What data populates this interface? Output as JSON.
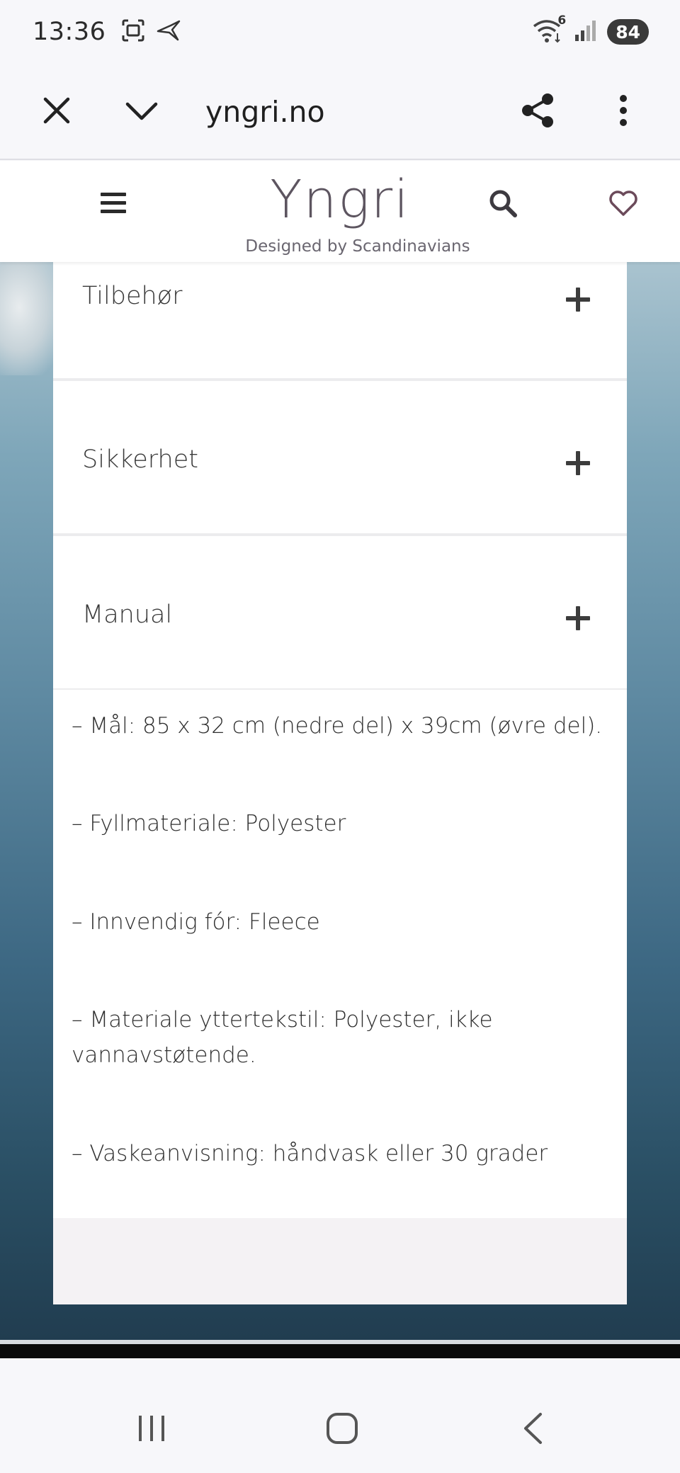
{
  "status_bar": {
    "time": "13:36",
    "battery": "84",
    "wifi_badge": "6",
    "icons": [
      "screenshot-icon",
      "bird-icon",
      "wifi-icon",
      "signal-icon"
    ]
  },
  "browser": {
    "url": "yngri.no",
    "icons": [
      "close-icon",
      "chevron-down-icon",
      "share-icon",
      "more-vert-icon"
    ]
  },
  "site_header": {
    "logo": "Yngri",
    "tagline": "Designed by Scandinavians",
    "icons": [
      "menu-icon",
      "search-icon",
      "heart-icon"
    ]
  },
  "accordion": [
    {
      "label": "Tilbehør"
    },
    {
      "label": "Sikkerhet"
    },
    {
      "label": "Manual"
    }
  ],
  "specs": [
    "– Mål: 85 x 32 cm (nedre del) x 39cm (øvre del).",
    "– Fyllmateriale: Polyester",
    "– Innvendig fór: Fleece",
    "– Materiale yttertekstil: Polyester, ikke vannavstøtende.",
    "– Vaskeanvisning: håndvask eller 30 grader"
  ],
  "nav_bar": {
    "icons": [
      "recent-apps-icon",
      "home-icon",
      "back-icon"
    ]
  },
  "colors": {
    "text": "#2b2b2b",
    "logo": "#5d5560",
    "heart": "#6b4a5a",
    "card": "#ffffff"
  }
}
